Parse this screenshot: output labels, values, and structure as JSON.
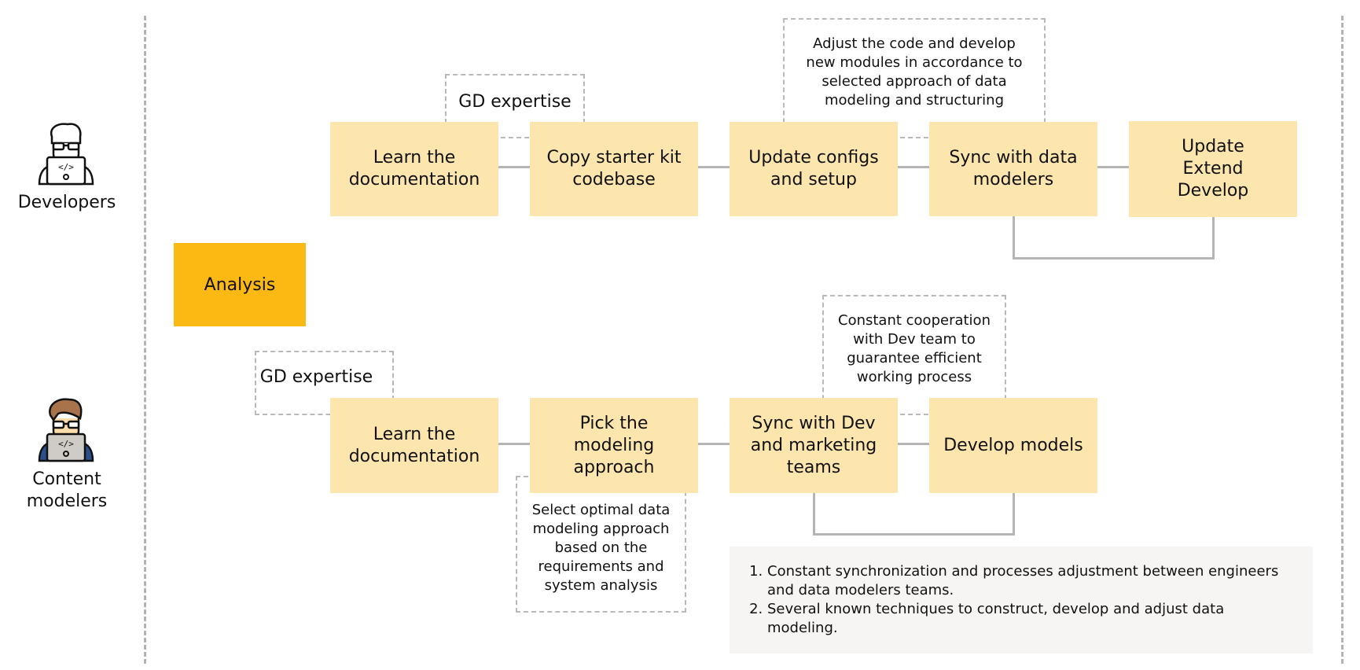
{
  "lanes": {
    "developers": {
      "label": "Developers",
      "icon": "developer-icon",
      "steps": [
        {
          "label": "Learn the\ndocumentation"
        },
        {
          "label": "Copy starter kit\ncodebase"
        },
        {
          "label": "Update configs\nand setup"
        },
        {
          "label": "Sync with data\nmodelers"
        },
        {
          "label": "Update\nExtend\nDevelop"
        }
      ],
      "notes": [
        {
          "text": "GD expertise"
        },
        {
          "text": "Adjust the code and develop\nnew modules in accordance to\nselected approach of data\nmodeling and structuring"
        }
      ]
    },
    "content_modelers": {
      "label": "Content\nmodelers",
      "icon": "content-modeler-icon",
      "steps": [
        {
          "label": "Learn the\ndocumentation"
        },
        {
          "label": "Pick the\nmodeling\napproach"
        },
        {
          "label": "Sync with Dev\nand marketing\nteams"
        },
        {
          "label": "Develop models"
        }
      ],
      "notes": [
        {
          "text": "GD expertise"
        },
        {
          "text": "Constant cooperation\nwith Dev team to\nguarantee efficient\nworking process"
        },
        {
          "text": "Select optimal data\nmodeling approach\nbased on the\nrequirements and\nsystem analysis"
        }
      ]
    }
  },
  "analysis": {
    "label": "Analysis"
  },
  "summary": {
    "items": [
      "Constant synchronization and processes adjustment between engineers and data modelers teams.",
      "Several known techniques to construct, develop and adjust data modeling."
    ]
  },
  "colors": {
    "step_fill": "#fde6ad",
    "analysis_fill": "#fdb913",
    "connector": "#b5b5b5",
    "dashed": "#b9b9b9",
    "summary_bg": "#f6f5f3"
  }
}
